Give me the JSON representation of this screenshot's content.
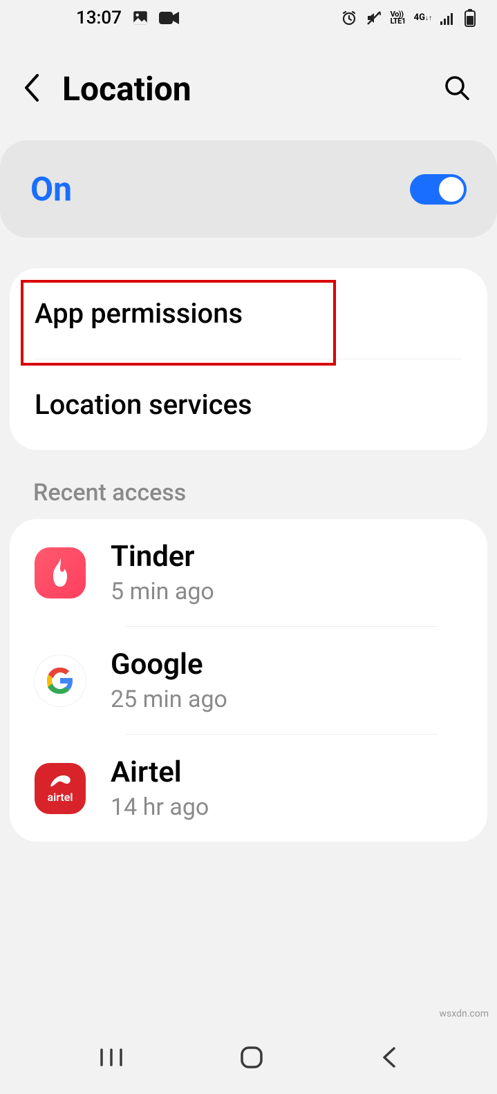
{
  "status": {
    "time": "13:07"
  },
  "header": {
    "title": "Location"
  },
  "toggle": {
    "label": "On",
    "state": true
  },
  "settings": [
    {
      "label": "App permissions",
      "highlighted": true
    },
    {
      "label": "Location services",
      "highlighted": false
    }
  ],
  "recent": {
    "section_label": "Recent access",
    "items": [
      {
        "name": "Tinder",
        "time": "5 min ago",
        "icon": "tinder"
      },
      {
        "name": "Google",
        "time": "25 min ago",
        "icon": "google"
      },
      {
        "name": "Airtel",
        "time": "14 hr ago",
        "icon": "airtel"
      }
    ]
  },
  "watermark": "wsxdn.com"
}
